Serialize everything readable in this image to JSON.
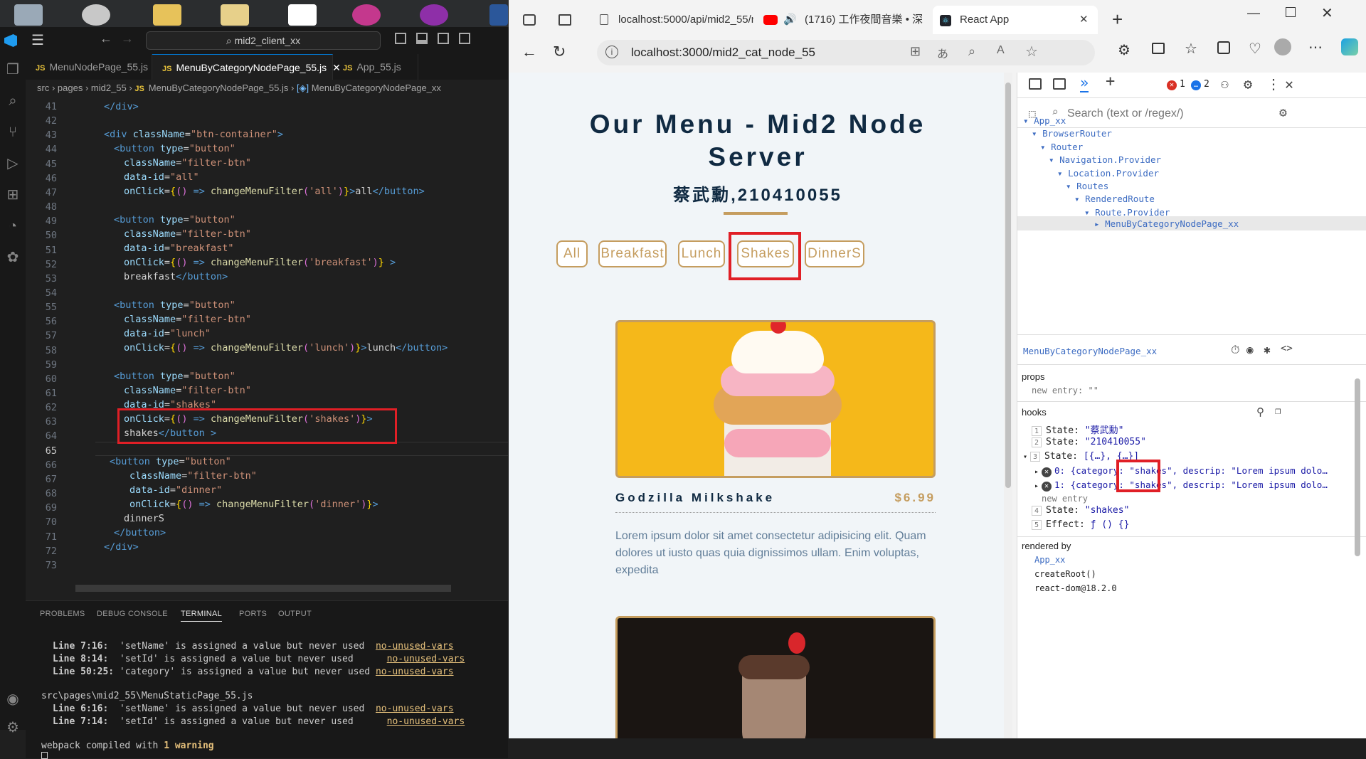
{
  "vscode": {
    "search": "mid2_client_xx",
    "tabs": [
      "MenuNodePage_55.js",
      "MenuByCategoryNodePage_55.js",
      "App_55.js"
    ],
    "breadcrumb": [
      "src",
      "pages",
      "mid2_55",
      "MenuByCategoryNodePage_55.js",
      "MenuByCategoryNodePage_xx"
    ],
    "line_numbers": [
      "41",
      "42",
      "43",
      "44",
      "45",
      "46",
      "47",
      "48",
      "49",
      "50",
      "51",
      "52",
      "53",
      "54",
      "55",
      "56",
      "57",
      "58",
      "59",
      "60",
      "61",
      "62",
      "63",
      "64",
      "65",
      "66",
      "67",
      "68",
      "69",
      "70",
      "71",
      "72",
      "73"
    ],
    "panel_tabs": [
      "PROBLEMS",
      "DEBUG CONSOLE",
      "TERMINAL",
      "PORTS",
      "OUTPUT"
    ],
    "terminal": {
      "w1_loc": "Line 7:16:",
      "w1_msg": "'setName' is assigned a value but never used",
      "w1_rule": "no-unused-vars",
      "w2_loc": "Line 8:14:",
      "w2_msg": "'setId' is assigned a value but never used",
      "w2_rule": "no-unused-vars",
      "w3_loc": "Line 50:25:",
      "w3_msg": "'category' is assigned a value but never used",
      "w3_rule": "no-unused-vars",
      "file2": "src\\pages\\mid2_55\\MenuStaticPage_55.js",
      "w4_loc": "Line 6:16:",
      "w4_msg": "'setName' is assigned a value but never used",
      "w4_rule": "no-unused-vars",
      "w5_loc": "Line 7:14:",
      "w5_msg": "'setId' is assigned a value but never used",
      "w5_rule": "no-unused-vars",
      "compiled_prefix": "webpack compiled with ",
      "compiled_warning": "1 warning"
    }
  },
  "browser": {
    "tab1": "localhost:5000/api/mid2_55/n",
    "tab2": "(1716) 工作夜間音樂 • 深",
    "tab3": "React App",
    "url": "localhost:3000/mid2_cat_node_55"
  },
  "page": {
    "title": "Our Menu - Mid2 Node Server",
    "student": "蔡武勳,210410055",
    "filters": [
      "All",
      "Breakfast",
      "Lunch",
      "Shakes",
      "DinnerS"
    ],
    "item": {
      "title": "Godzilla Milkshake",
      "price": "$6.99",
      "desc": "Lorem ipsum dolor sit amet consectetur adipisicing elit. Quam dolores ut iusto quas quia dignissimos ullam. Enim voluptas, expedita"
    }
  },
  "devtools": {
    "error_count": "1",
    "msg_count": "2",
    "search_placeholder": "Search (text or /regex/)",
    "tree": [
      "App_xx",
      "BrowserRouter",
      "Router",
      "Navigation.Provider",
      "Location.Provider",
      "Routes",
      "RenderedRoute",
      "Route.Provider",
      "MenuByCategoryNodePage_xx"
    ],
    "selected": "MenuByCategoryNodePage_xx",
    "props_label": "props",
    "new_entry": "new entry",
    "props_value": "\"\"",
    "hooks_label": "hooks",
    "h1_label": "State:",
    "h1_value": "\"蔡武勳\"",
    "h2_label": "State:",
    "h2_value": "\"210410055\"",
    "h3_label": "State:",
    "h3_value": "[{…}, {…}]",
    "h3_0_pre": "0: {category: ",
    "h3_0_cat": "\"shakes\"",
    "h3_0_post": ", descrip: \"Lorem ipsum dolo…",
    "h3_1_pre": "1: {category: ",
    "h3_1_cat": "\"shakes\"",
    "h3_1_post": ", descrip: \"Lorem ipsum dolo…",
    "h4_label": "State:",
    "h4_value": "\"shakes\"",
    "h5_label": "Effect:",
    "h5_value": "ƒ () {}",
    "rendered_by": "rendered by",
    "rb": [
      "App_xx",
      "createRoot()",
      "react-dom@18.2.0"
    ]
  }
}
